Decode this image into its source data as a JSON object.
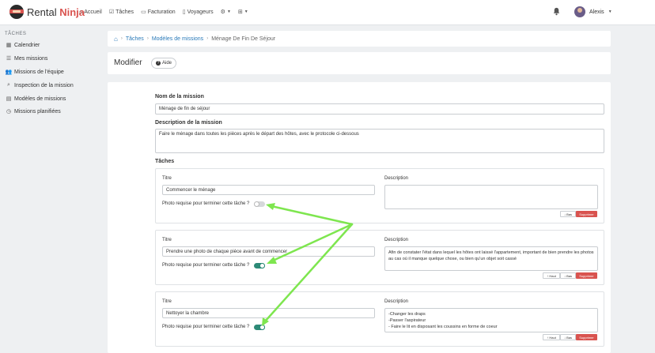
{
  "brand": {
    "name_part1": "Rental ",
    "name_part2": "Ninja"
  },
  "nav": {
    "accueil": "Accueil",
    "taches": "Tâches",
    "facturation": "Facturation",
    "voyageurs": "Voyageurs"
  },
  "user": {
    "name": "Alexis"
  },
  "sidebar": {
    "header": "TÂCHES",
    "items": [
      {
        "label": "Calendrier",
        "icon": "calendar-icon"
      },
      {
        "label": "Mes missions",
        "icon": "checklist-icon"
      },
      {
        "label": "Missions de l'équipe",
        "icon": "team-icon"
      },
      {
        "label": "Inspection de la mission",
        "icon": "search-icon"
      },
      {
        "label": "Modèles de missions",
        "icon": "template-icon"
      },
      {
        "label": "Missions planifiées",
        "icon": "clock-icon"
      }
    ]
  },
  "breadcrumb": {
    "items": [
      "Tâches",
      "Modèles de missions"
    ],
    "current": "Ménage De Fin De Séjour"
  },
  "page": {
    "title": "Modifier",
    "help_label": "Aide"
  },
  "form": {
    "name_label": "Nom de la mission",
    "name_value": "Ménage de fin de séjour",
    "description_label": "Description de la mission",
    "description_value": "Faire le ménage dans toutes les pièces après le départ des hôtes, avec le protocole ci-dessous",
    "tasks_label": "Tâches"
  },
  "task_labels": {
    "title": "Titre",
    "description": "Description",
    "photo_required": "Photo requise pour terminer cette tâche ?",
    "up": "Haut",
    "down": "Bas",
    "delete": "Supprimer"
  },
  "tasks": [
    {
      "title": "Commencer le ménage",
      "description": "",
      "photo_required": false
    },
    {
      "title": "Prendre une photo de chaque pièce avant  de commencer",
      "description": "Afin de constater l'état dans lequel les hôtes ont laissé l'appartement, important de bien prendre les photos au cas où il manque quelque chose, ou bien qu'un objet soit cassé",
      "photo_required": true
    },
    {
      "title": "Nettoyer la chambre",
      "description_lines": [
        "-Changer les draps",
        "-Passer l'aspirateur",
        "- Faire le lit en disposant les coussins en forme de coeur"
      ],
      "photo_required": true
    }
  ],
  "annotation_color": "#7ee64f",
  "accent": "#2d8a77",
  "danger": "#d9534f"
}
